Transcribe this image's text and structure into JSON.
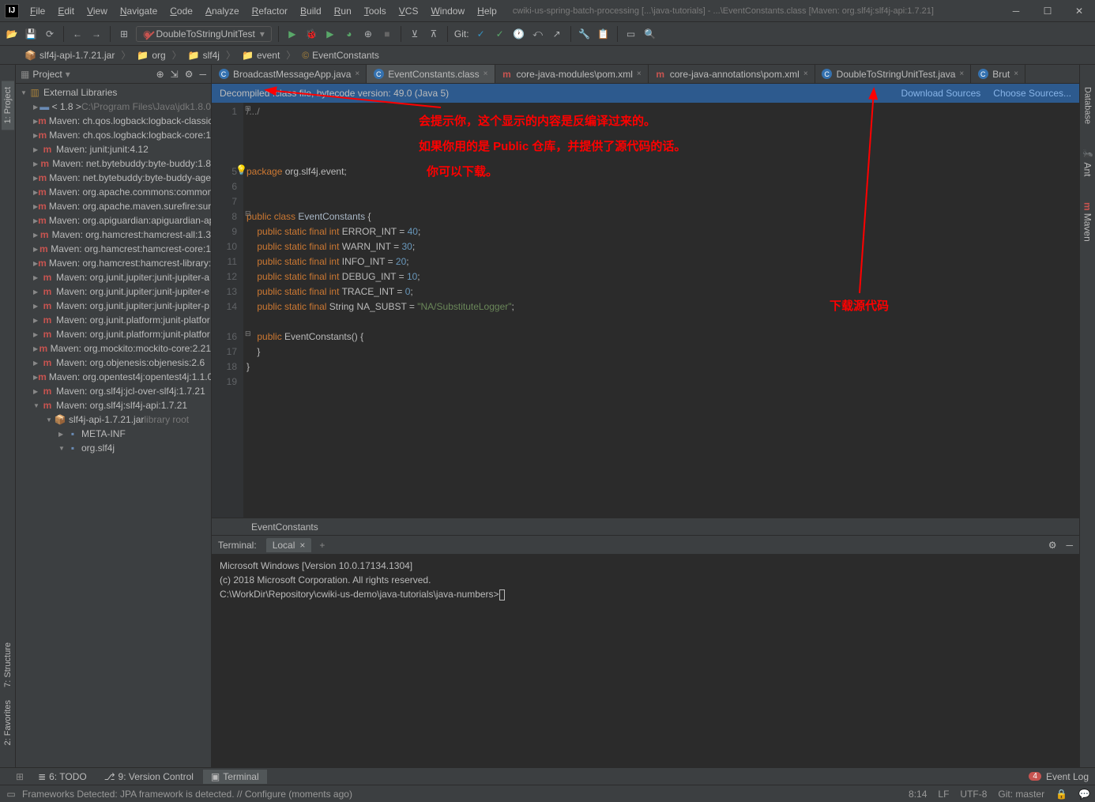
{
  "menu": [
    "File",
    "Edit",
    "View",
    "Navigate",
    "Code",
    "Analyze",
    "Refactor",
    "Build",
    "Run",
    "Tools",
    "VCS",
    "Window",
    "Help"
  ],
  "window_title": "cwiki-us-spring-batch-processing [...\\java-tutorials] - ...\\EventConstants.class [Maven: org.slf4j:slf4j-api:1.7.21]",
  "run_config": "DoubleToStringUnitTest",
  "git_label": "Git:",
  "breadcrumb": [
    "slf4j-api-1.7.21.jar",
    "org",
    "slf4j",
    "event",
    "EventConstants"
  ],
  "panel": {
    "title": "Project"
  },
  "tree": [
    {
      "depth": 0,
      "arrow": "▼",
      "icon": "libs",
      "text": "External Libraries",
      "gray": ""
    },
    {
      "depth": 1,
      "arrow": "▶",
      "icon": "folder",
      "text": "< 1.8 >",
      "gray": "C:\\Program Files\\Java\\jdk1.8.0"
    },
    {
      "depth": 1,
      "arrow": "▶",
      "icon": "m",
      "text": "Maven: ch.qos.logback:logback-classic",
      "gray": ""
    },
    {
      "depth": 1,
      "arrow": "▶",
      "icon": "m",
      "text": "Maven: ch.qos.logback:logback-core:1",
      "gray": ""
    },
    {
      "depth": 1,
      "arrow": "▶",
      "icon": "m",
      "text": "Maven: junit:junit:4.12",
      "gray": ""
    },
    {
      "depth": 1,
      "arrow": "▶",
      "icon": "m",
      "text": "Maven: net.bytebuddy:byte-buddy:1.8",
      "gray": ""
    },
    {
      "depth": 1,
      "arrow": "▶",
      "icon": "m",
      "text": "Maven: net.bytebuddy:byte-buddy-age",
      "gray": ""
    },
    {
      "depth": 1,
      "arrow": "▶",
      "icon": "m",
      "text": "Maven: org.apache.commons:common",
      "gray": ""
    },
    {
      "depth": 1,
      "arrow": "▶",
      "icon": "m",
      "text": "Maven: org.apache.maven.surefire:sure",
      "gray": ""
    },
    {
      "depth": 1,
      "arrow": "▶",
      "icon": "m",
      "text": "Maven: org.apiguardian:apiguardian-ap",
      "gray": ""
    },
    {
      "depth": 1,
      "arrow": "▶",
      "icon": "m",
      "text": "Maven: org.hamcrest:hamcrest-all:1.3",
      "gray": ""
    },
    {
      "depth": 1,
      "arrow": "▶",
      "icon": "m",
      "text": "Maven: org.hamcrest:hamcrest-core:1",
      "gray": ""
    },
    {
      "depth": 1,
      "arrow": "▶",
      "icon": "m",
      "text": "Maven: org.hamcrest:hamcrest-library:",
      "gray": ""
    },
    {
      "depth": 1,
      "arrow": "▶",
      "icon": "m",
      "text": "Maven: org.junit.jupiter:junit-jupiter-a",
      "gray": ""
    },
    {
      "depth": 1,
      "arrow": "▶",
      "icon": "m",
      "text": "Maven: org.junit.jupiter:junit-jupiter-e",
      "gray": ""
    },
    {
      "depth": 1,
      "arrow": "▶",
      "icon": "m",
      "text": "Maven: org.junit.jupiter:junit-jupiter-p",
      "gray": ""
    },
    {
      "depth": 1,
      "arrow": "▶",
      "icon": "m",
      "text": "Maven: org.junit.platform:junit-platfor",
      "gray": ""
    },
    {
      "depth": 1,
      "arrow": "▶",
      "icon": "m",
      "text": "Maven: org.junit.platform:junit-platfor",
      "gray": ""
    },
    {
      "depth": 1,
      "arrow": "▶",
      "icon": "m",
      "text": "Maven: org.mockito:mockito-core:2.21",
      "gray": ""
    },
    {
      "depth": 1,
      "arrow": "▶",
      "icon": "m",
      "text": "Maven: org.objenesis:objenesis:2.6",
      "gray": ""
    },
    {
      "depth": 1,
      "arrow": "▶",
      "icon": "m",
      "text": "Maven: org.opentest4j:opentest4j:1.1.0",
      "gray": ""
    },
    {
      "depth": 1,
      "arrow": "▶",
      "icon": "m",
      "text": "Maven: org.slf4j:jcl-over-slf4j:1.7.21",
      "gray": ""
    },
    {
      "depth": 1,
      "arrow": "▼",
      "icon": "m",
      "text": "Maven: org.slf4j:slf4j-api:1.7.21",
      "gray": ""
    },
    {
      "depth": 2,
      "arrow": "▼",
      "icon": "jar",
      "text": "slf4j-api-1.7.21.jar",
      "gray": "library root"
    },
    {
      "depth": 3,
      "arrow": "▶",
      "icon": "pkg",
      "text": "META-INF",
      "gray": ""
    },
    {
      "depth": 3,
      "arrow": "▼",
      "icon": "pkg",
      "text": "org.slf4j",
      "gray": ""
    }
  ],
  "tabs": [
    {
      "icon": "c",
      "label": "BroadcastMessageApp.java",
      "active": false
    },
    {
      "icon": "c",
      "label": "EventConstants.class",
      "active": true
    },
    {
      "icon": "m",
      "label": "core-java-modules\\pom.xml",
      "active": false
    },
    {
      "icon": "m",
      "label": "core-java-annotations\\pom.xml",
      "active": false
    },
    {
      "icon": "c",
      "label": "DoubleToStringUnitTest.java",
      "active": false
    },
    {
      "icon": "c",
      "label": "Brut",
      "active": false
    }
  ],
  "info_bar": {
    "msg": "Decompiled .class file, bytecode version: 49.0 (Java 5)",
    "link1": "Download Sources",
    "link2": "Choose Sources..."
  },
  "linenums": [
    "1",
    "",
    "",
    "",
    "5",
    "6",
    "7",
    "8",
    "9",
    "10",
    "11",
    "12",
    "13",
    "14",
    "",
    "16",
    "17",
    "18",
    "19"
  ],
  "code_html": "<span class='cmt'>/.../</span>\n\n\n\n<span class='kw'>package</span> org.slf4j.event;\n\n\n<span class='kw'>public</span> <span class='kw'>class</span> <span class='cls'>EventConstants</span> {\n    <span class='kw'>public</span> <span class='kw'>static</span> <span class='kw'>final</span> <span class='kw'>int</span> ERROR_INT = <span class='num'>40</span>;\n    <span class='kw'>public</span> <span class='kw'>static</span> <span class='kw'>final</span> <span class='kw'>int</span> WARN_INT = <span class='num'>30</span>;\n    <span class='kw'>public</span> <span class='kw'>static</span> <span class='kw'>final</span> <span class='kw'>int</span> INFO_INT = <span class='num'>20</span>;\n    <span class='kw'>public</span> <span class='kw'>static</span> <span class='kw'>final</span> <span class='kw'>int</span> DEBUG_INT = <span class='num'>10</span>;\n    <span class='kw'>public</span> <span class='kw'>static</span> <span class='kw'>final</span> <span class='kw'>int</span> TRACE_INT = <span class='num'>0</span>;\n    <span class='kw'>public</span> <span class='kw'>static</span> <span class='kw'>final</span> String NA_SUBST = <span class='str'>\"NA/SubstituteLogger\"</span>;\n\n    <span class='kw'>public</span> EventConstants() {\n    }\n}\n",
  "editor_crumb": "EventConstants",
  "annot": {
    "line1": "会提示你，这个显示的内容是反编译过来的。",
    "line2": "如果你用的是 Public 仓库，并提供了源代码的话。",
    "line3": "你可以下载。",
    "right": "下载源代码"
  },
  "terminal": {
    "title": "Terminal:",
    "tab": "Local",
    "lines": "Microsoft Windows [Version 10.0.17134.1304]\n(c) 2018 Microsoft Corporation. All rights reserved.\nC:\\WorkDir\\Repository\\cwiki-us-demo\\java-tutorials\\java-numbers>"
  },
  "left_tools": [
    "2: Favorites",
    "7: Structure",
    "1: Project"
  ],
  "right_tools": [
    "Database",
    "Ant",
    "Maven"
  ],
  "bottom_tools": [
    {
      "label": "6: TODO",
      "icon": "✓"
    },
    {
      "label": "9: Version Control",
      "icon": "⎇"
    },
    {
      "label": "Terminal",
      "icon": "▣",
      "active": true
    }
  ],
  "event_log": {
    "badge": "4",
    "label": "Event Log"
  },
  "status": {
    "msg": "Frameworks Detected: JPA framework is detected. // Configure (moments ago)",
    "pos": "8:14",
    "le": "LF",
    "enc": "UTF-8",
    "git": "Git: master"
  }
}
